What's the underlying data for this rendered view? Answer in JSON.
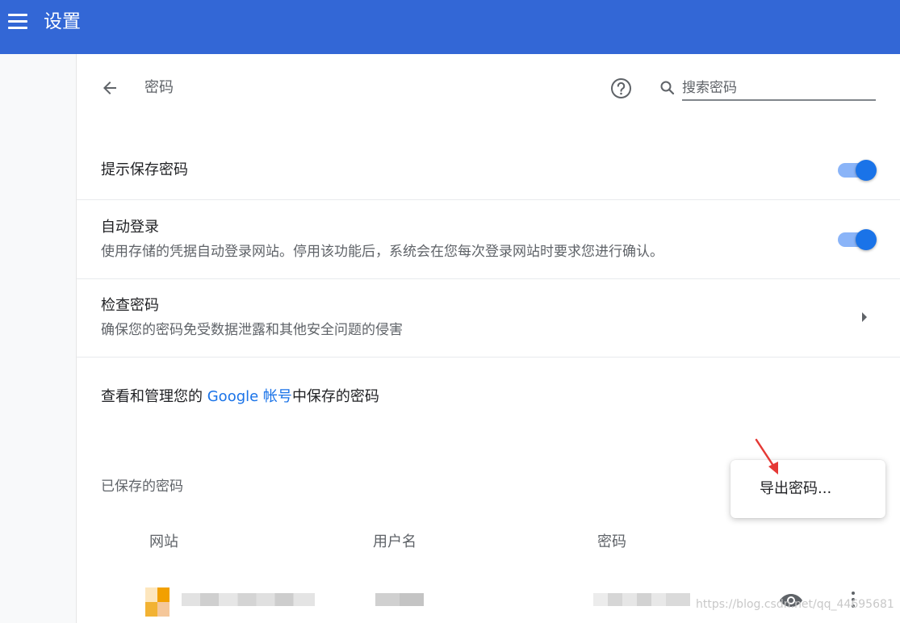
{
  "header": {
    "title": "设置",
    "background": "#3367d6",
    "menu_icon": "hamburger-menu-icon"
  },
  "page": {
    "title": "密码",
    "back_icon": "back-arrow-icon",
    "help_icon": "help-circle-icon",
    "search": {
      "icon": "search-icon",
      "placeholder": "搜索密码",
      "value": ""
    }
  },
  "settings": {
    "offer_to_save": {
      "label": "提示保存密码",
      "enabled": true
    },
    "auto_signin": {
      "label": "自动登录",
      "description": "使用存储的凭据自动登录网站。停用该功能后，系统会在您每次登录网站时要求您进行确认。",
      "enabled": true
    },
    "check_passwords": {
      "label": "检查密码",
      "description": "确保您的密码免受数据泄露和其他安全问题的侵害",
      "icon": "chevron-right-icon"
    },
    "manage_account": {
      "prefix": "查看和管理您的 ",
      "link": "Google 帐号",
      "suffix": "中保存的密码"
    }
  },
  "saved_passwords": {
    "heading": "已保存的密码",
    "columns": [
      "网站",
      "用户名",
      "密码"
    ],
    "row_actions": {
      "show_icon": "eye-icon",
      "more_icon": "more-vert-icon"
    }
  },
  "popup_menu": {
    "items": [
      {
        "label": "导出密码..."
      }
    ]
  },
  "annotation": {
    "arrow_color": "#e53935"
  },
  "watermark": "https://blog.csdn.net/qq_44695681",
  "colors": {
    "accent": "#1a73e8",
    "toggle_track": "#8ab4f8",
    "header": "#3367d6"
  }
}
